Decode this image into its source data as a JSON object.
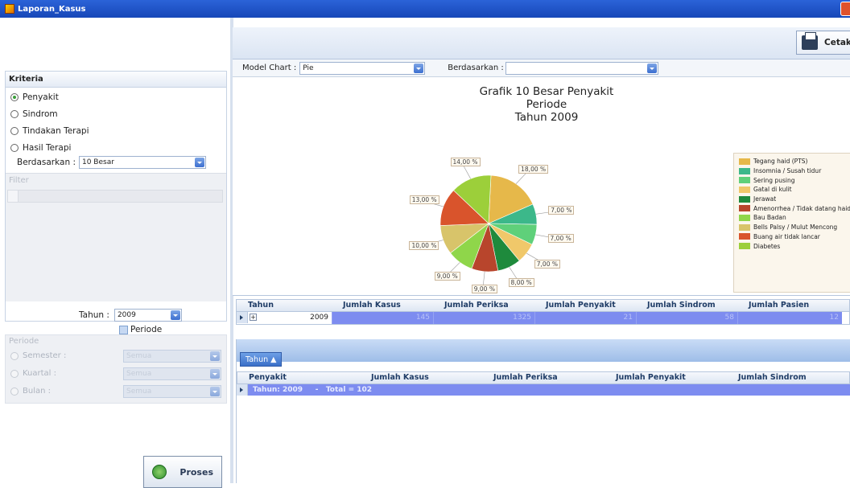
{
  "window": {
    "title": "Laporan_Kasus"
  },
  "left_panel": {
    "criteria_title": "Kriteria",
    "radios": [
      "Penyakit",
      "Sindrom",
      "Tindakan Terapi",
      "Hasil Terapi"
    ],
    "selected_radio": "Penyakit",
    "berdasarkan_label": "Berdasarkan :",
    "berdasarkan_value": "10 Besar",
    "filter_label": "Filter",
    "tahun_label": "Tahun :",
    "tahun_value": "2009",
    "periode_check_label": "Periode",
    "periode_title": "Periode",
    "periode_rows": [
      {
        "label": "Semester :",
        "value": "Semua"
      },
      {
        "label": "Kuartal :",
        "value": "Semua"
      },
      {
        "label": "Bulan :",
        "value": "Semua"
      }
    ],
    "proses_label": "Proses"
  },
  "toolbar": {
    "cetak_label": "Cetak"
  },
  "chart_controls": {
    "model_label": "Model Chart :",
    "model_value": "Pie",
    "berdasarkan_label": "Berdasarkan :",
    "berdasarkan_value": ""
  },
  "chart_data": {
    "type": "pie",
    "title_lines": [
      "Grafik 10 Besar Penyakit",
      "Periode",
      "Tahun 2009"
    ],
    "labels": [
      "Tegang haid (PTS)",
      "Insomnia / Susah tidur",
      "Sering pusing",
      "Gatal di kulit",
      "Jerawat",
      "Amenorrhea / Tidak datang haid",
      "Bau Badan",
      "Bells Palsy / Mulut Mencong",
      "Buang air tidak lancar",
      "Diabetes"
    ],
    "slices": [
      {
        "label": "Tegang haid (PTS)",
        "value": 18.0,
        "text": "18,00 %",
        "color": "#e6b84a"
      },
      {
        "label": "Insomnia / Susah tidur",
        "value": 7.0,
        "text": "7,00 %",
        "color": "#3cb88a"
      },
      {
        "label": "Sering pusing",
        "value": 7.0,
        "text": "7,00 %",
        "color": "#5fd07a"
      },
      {
        "label": "Gatal di kulit",
        "value": 7.0,
        "text": "7,00 %",
        "color": "#f0c86a"
      },
      {
        "label": "Jerawat",
        "value": 8.0,
        "text": "8,00 %",
        "color": "#1e8a3c"
      },
      {
        "label": "Amenorrhea / Tidak datang haid",
        "value": 9.0,
        "text": "9,00 %",
        "color": "#b8452c"
      },
      {
        "label": "Bau Badan",
        "value": 9.0,
        "text": "9,00 %",
        "color": "#8fd64a"
      },
      {
        "label": "Bells Palsy / Mulut Mencong",
        "value": 10.0,
        "text": "10,00 %",
        "color": "#d8c46a"
      },
      {
        "label": "Buang air tidak lancar",
        "value": 13.0,
        "text": "13,00 %",
        "color": "#d9542c"
      },
      {
        "label": "Diabetes",
        "value": 14.0,
        "text": "14,00 %",
        "color": "#9ccf3a"
      }
    ]
  },
  "summary_grid": {
    "columns": [
      "Tahun",
      "Jumlah Kasus",
      "Jumlah Periksa",
      "Jumlah Penyakit",
      "Jumlah Sindrom",
      "Jumlah Pasien"
    ],
    "row": {
      "tahun": "2009",
      "kasus": "145",
      "periksa": "1325",
      "penyakit": "21",
      "sindrom": "58",
      "pasien": "12"
    }
  },
  "detail_grid": {
    "group_button": "Tahun ▲",
    "columns": [
      "Penyakit",
      "Jumlah Kasus",
      "Jumlah Periksa",
      "Jumlah Penyakit",
      "Jumlah Sindrom"
    ],
    "group_row": "Tahun: 2009     -   Total = 102"
  }
}
